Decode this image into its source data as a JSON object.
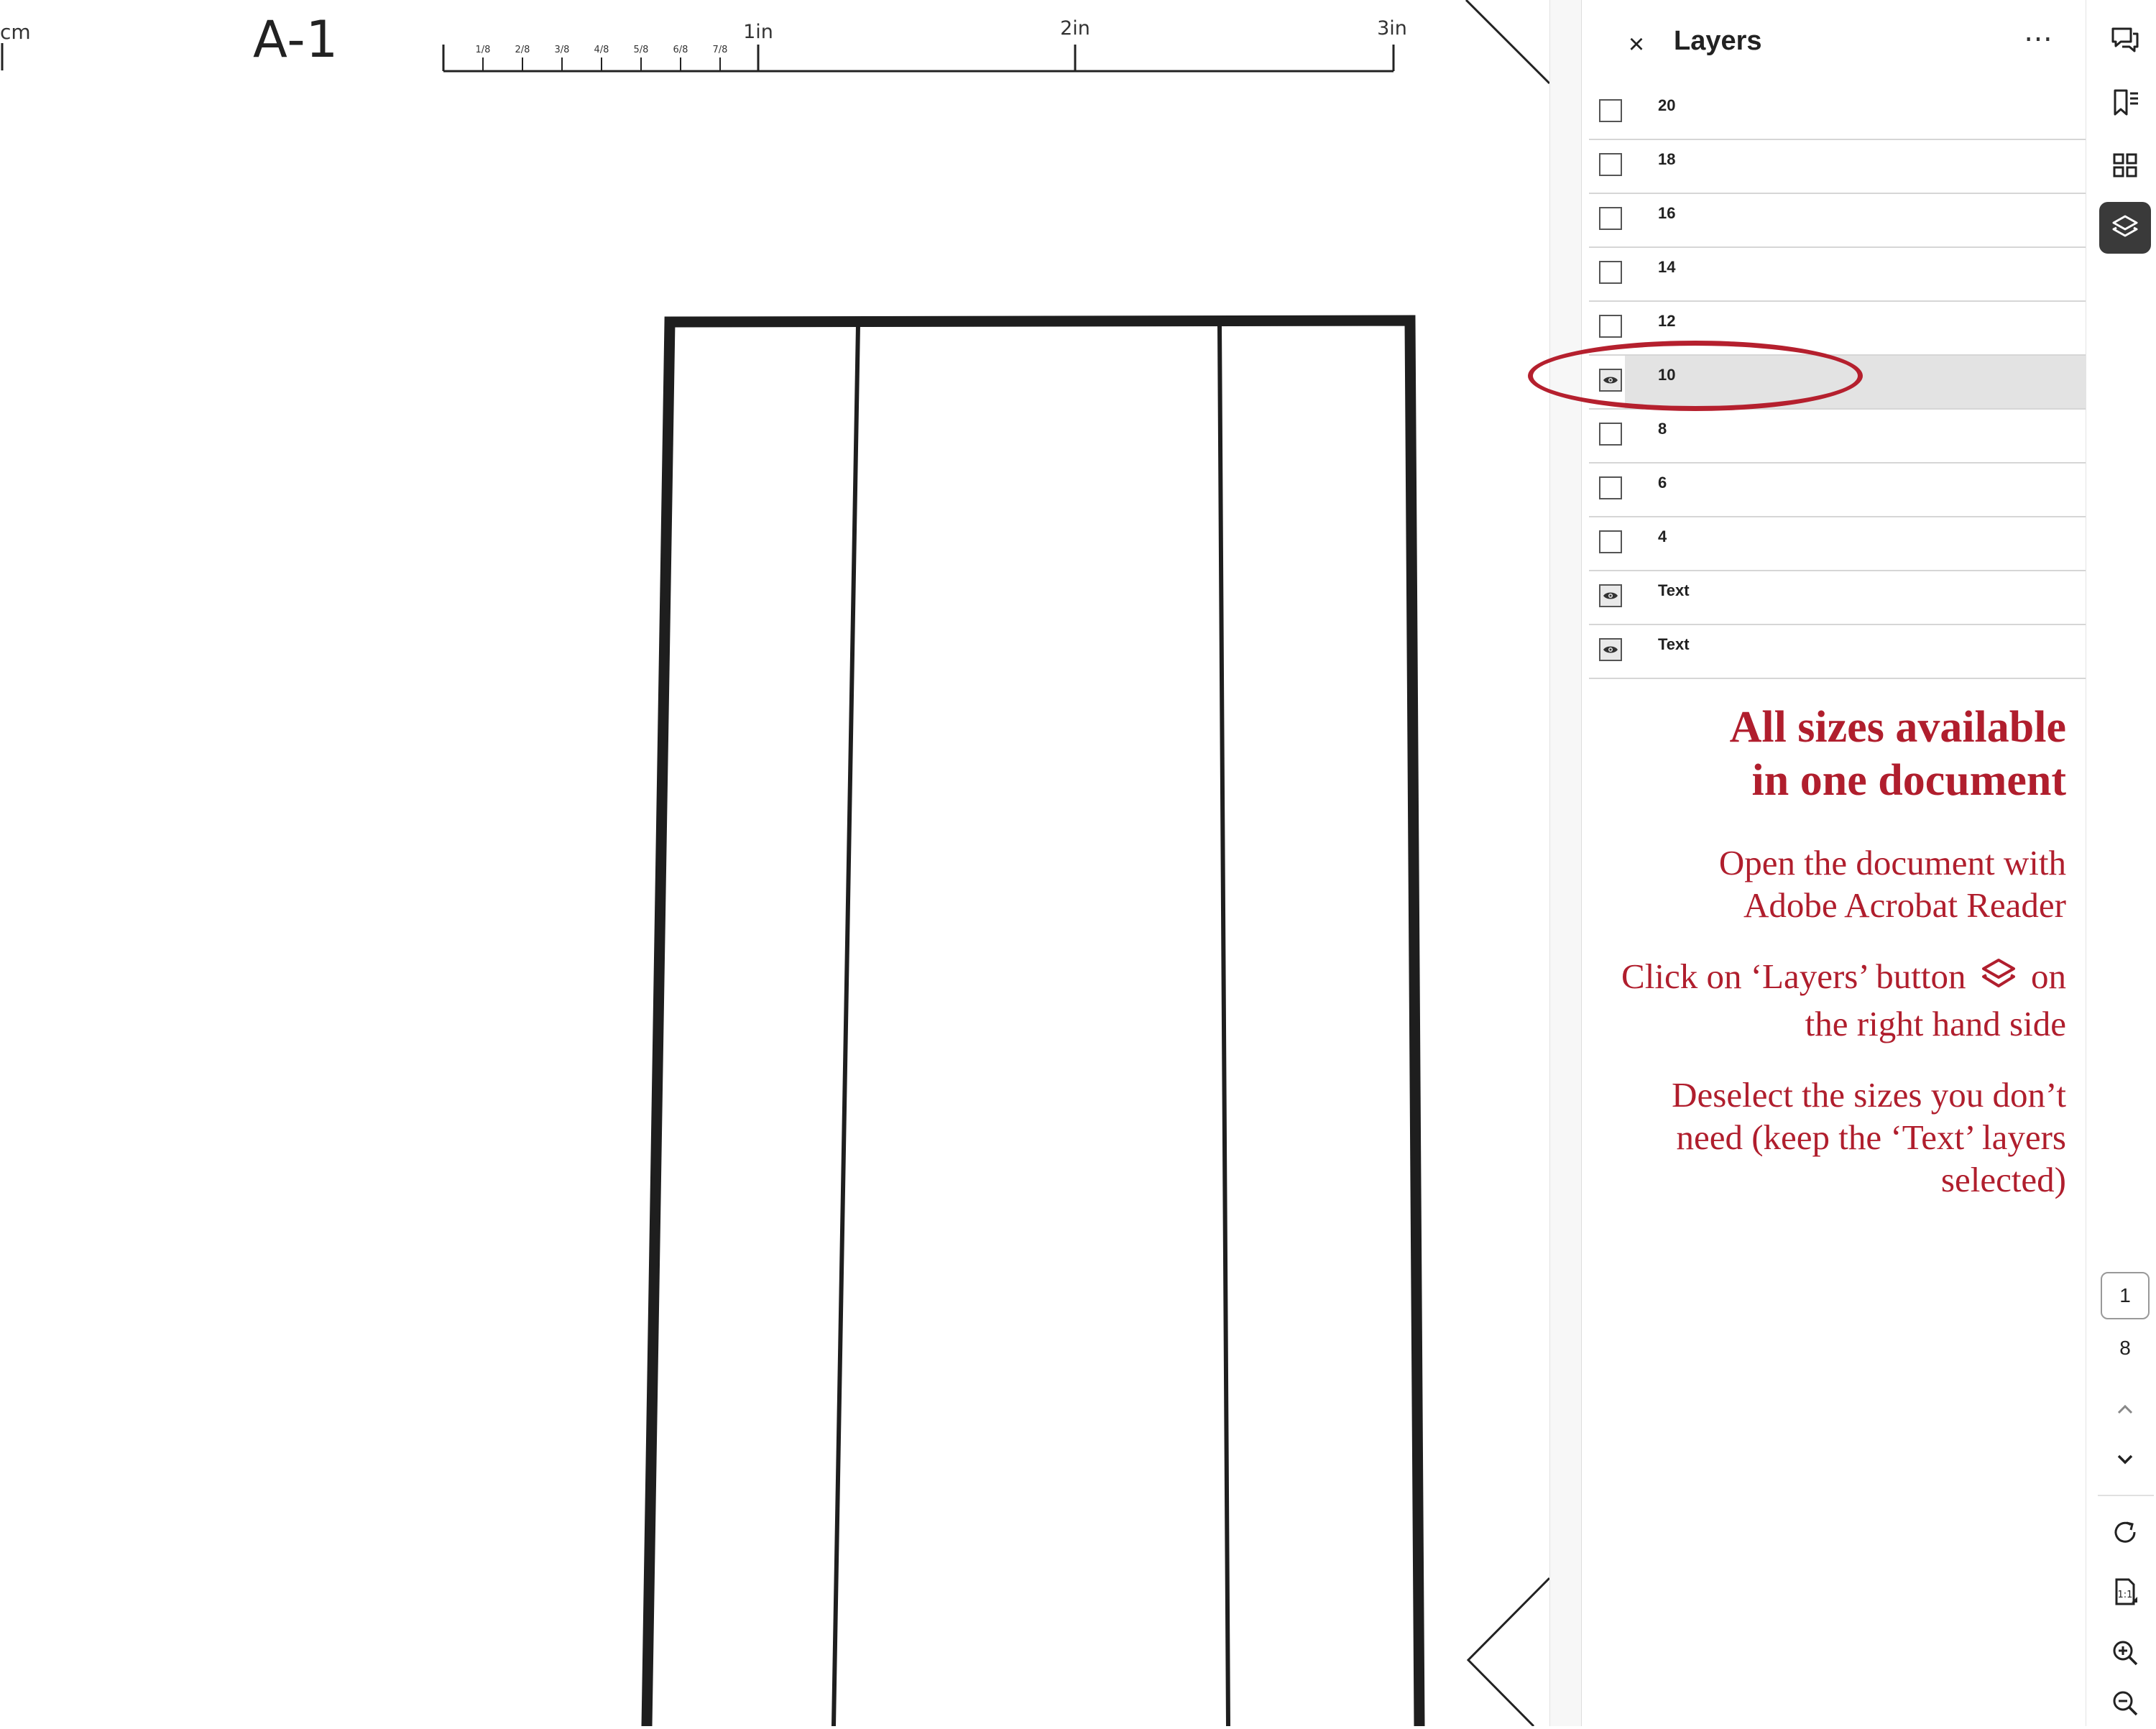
{
  "document": {
    "page_code": "A-1",
    "cm_label": "cm",
    "ruler": {
      "unit_labels": [
        "1in",
        "2in",
        "3in"
      ],
      "fraction_labels": [
        "1/8",
        "2/8",
        "3/8",
        "4/8",
        "5/8",
        "6/8",
        "7/8"
      ]
    }
  },
  "layers_panel": {
    "title": "Layers",
    "close_icon": "×",
    "more_icon": "⋯",
    "layers": [
      {
        "label": "20",
        "visible": false,
        "selected": false
      },
      {
        "label": "18",
        "visible": false,
        "selected": false
      },
      {
        "label": "16",
        "visible": false,
        "selected": false
      },
      {
        "label": "14",
        "visible": false,
        "selected": false
      },
      {
        "label": "12",
        "visible": false,
        "selected": false
      },
      {
        "label": "10",
        "visible": true,
        "selected": true
      },
      {
        "label": "8",
        "visible": false,
        "selected": false
      },
      {
        "label": "6",
        "visible": false,
        "selected": false
      },
      {
        "label": "4",
        "visible": false,
        "selected": false
      },
      {
        "label": "Text",
        "visible": true,
        "selected": false
      },
      {
        "label": "Text",
        "visible": true,
        "selected": false
      }
    ],
    "highlight_color": "#b5202e"
  },
  "instructions": {
    "title_line1": "All sizes available",
    "title_line2": "in one document",
    "para1_line1": "Open the document with",
    "para1_line2": "Adobe Acrobat Reader",
    "para2_part1": "Click on ‘Layers’ button",
    "para2_part2": "on",
    "para2_line2": "the right hand side",
    "para3_line1": "Deselect the sizes you don’t",
    "para3_line2": "need (keep the ‘Text’ layers",
    "para3_line3": "selected)",
    "color": "#b01e2d"
  },
  "toolbar": {
    "items": [
      "comment-icon",
      "bookmarks-icon",
      "thumbnails-icon",
      "layers-icon",
      "rotate-icon",
      "fit-page-icon",
      "zoom-in-icon",
      "zoom-out-icon"
    ],
    "active": "layers-icon",
    "page_current": "1",
    "page_total": "8"
  }
}
